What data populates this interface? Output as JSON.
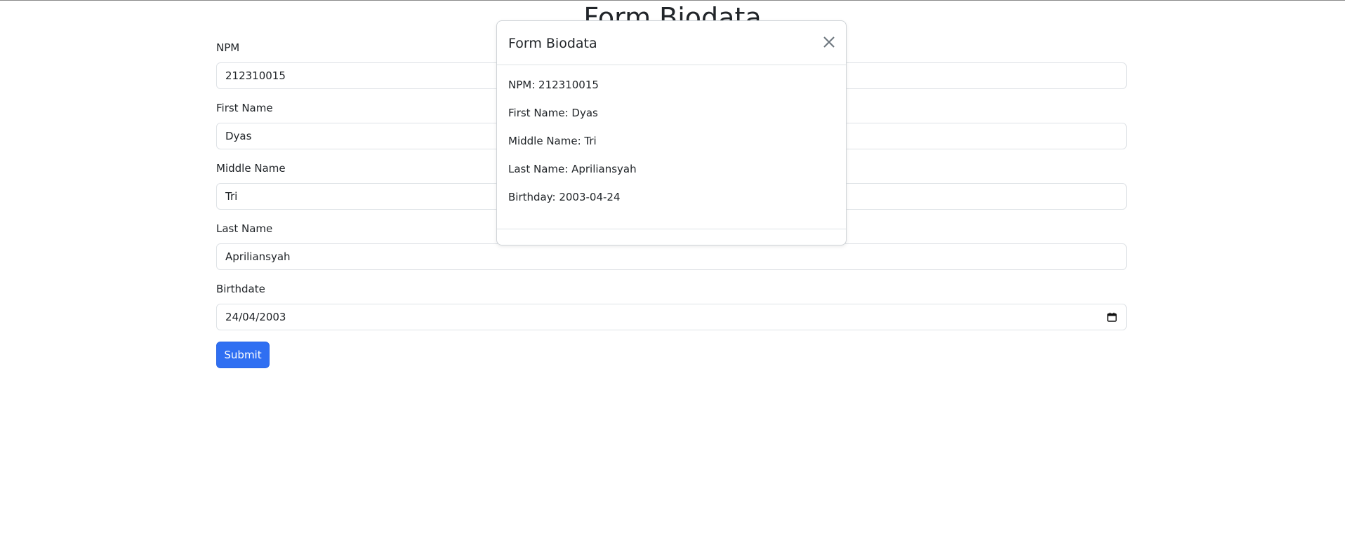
{
  "page": {
    "title": "Form Biodata"
  },
  "form": {
    "npm": {
      "label": "NPM",
      "value": "212310015"
    },
    "first_name": {
      "label": "First Name",
      "value": "Dyas"
    },
    "middle_name": {
      "label": "Middle Name",
      "value": "Tri"
    },
    "last_name": {
      "label": "Last Name",
      "value": "Apriliansyah"
    },
    "birthdate": {
      "label": "Birthdate",
      "value": "24/04/2003",
      "icon": "calendar-icon"
    },
    "submit_label": "Submit"
  },
  "modal": {
    "title": "Form Biodata",
    "close_icon": "close-icon",
    "lines": [
      "NPM: 212310015",
      "First Name: Dyas",
      "Middle Name: Tri",
      "Last Name: Apriliansyah",
      "Birthday: 2003-04-24"
    ]
  },
  "colors": {
    "primary": "#2f6ff2",
    "border": "#dee2e6",
    "text": "#212529"
  }
}
